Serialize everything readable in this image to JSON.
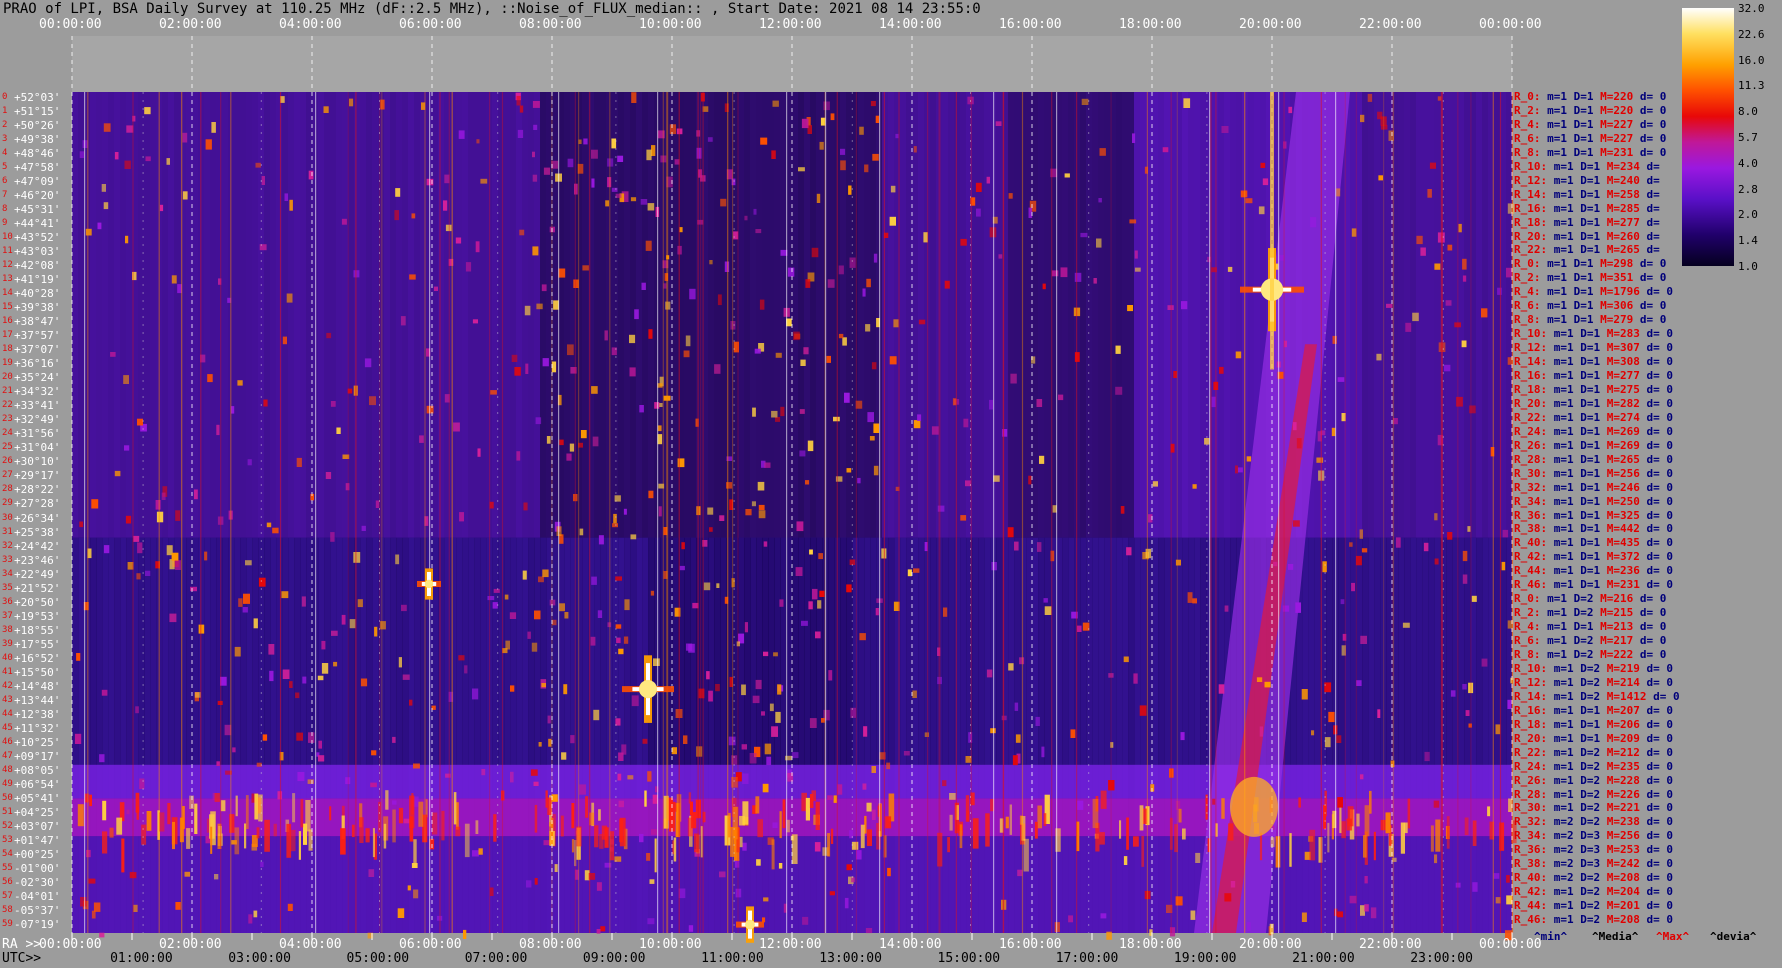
{
  "title": "PRAO of LPI, BSA Daily Survey at 110.25 MHz (dF::2.5 MHz), ::Noise_of_FLUX_median:: , Start Date: 2021 08 14 23:55:0",
  "chart_data": {
    "type": "heatmap",
    "title": "PRAO of LPI, BSA Daily Survey at 110.25 MHz (dF::2.5 MHz), ::Noise_of_FLUX_median:: , Start Date: 2021 08 14 23:55:0",
    "top_axis_labels": [
      "00:00:00",
      "02:00:00",
      "04:00:00",
      "06:00:00",
      "08:00:00",
      "10:00:00",
      "12:00:00",
      "14:00:00",
      "16:00:00",
      "18:00:00",
      "20:00:00",
      "22:00:00",
      "00:00:00"
    ],
    "ra_axis_prefix": "RA >>",
    "ra_axis_labels": [
      "00:00:00",
      "02:00:00",
      "04:00:00",
      "06:00:00",
      "08:00:00",
      "10:00:00",
      "12:00:00",
      "14:00:00",
      "16:00:00",
      "18:00:00",
      "20:00:00",
      "22:00:00",
      "00:00:00"
    ],
    "utc_axis_prefix": "UTC>>",
    "utc_axis_labels": [
      "01:00:00",
      "03:00:00",
      "05:00:00",
      "07:00:00",
      "09:00:00",
      "11:00:00",
      "13:00:00",
      "15:00:00",
      "17:00:00",
      "19:00:00",
      "21:00:00",
      "23:00:00"
    ],
    "declinations": [
      "+52°03'",
      "+51°15'",
      "+50°26'",
      "+49°38'",
      "+48°46'",
      "+47°58'",
      "+47°09'",
      "+46°20'",
      "+45°31'",
      "+44°41'",
      "+43°52'",
      "+43°03'",
      "+42°08'",
      "+41°19'",
      "+40°28'",
      "+39°38'",
      "+38°47'",
      "+37°57'",
      "+37°07'",
      "+36°16'",
      "+35°24'",
      "+34°32'",
      "+33°41'",
      "+32°49'",
      "+31°56'",
      "+31°04'",
      "+30°10'",
      "+29°17'",
      "+28°22'",
      "+27°28'",
      "+26°34'",
      "+25°38'",
      "+24°42'",
      "+23°46'",
      "+22°49'",
      "+21°52'",
      "+20°50'",
      "+19°53'",
      "+18°55'",
      "+17°55'",
      "+16°52'",
      "+15°50'",
      "+14°48'",
      "+13°44'",
      "+12°38'",
      "+11°32'",
      "+10°25'",
      "+09°17'",
      "+08°05'",
      "+06°54'",
      "+05°41'",
      "+04°25'",
      "+03°07'",
      "+01°47'",
      "+00°25'",
      "-01°00'",
      "-02°30'",
      "-04°01'",
      "-05°37'",
      "-07°19'"
    ],
    "colorbar": {
      "ticks": [
        "32.0",
        "22.6",
        "16.0",
        "11.3",
        "8.0",
        "5.7",
        "4.0",
        "2.8",
        "2.0",
        "1.4",
        "1.0"
      ],
      "values": [
        32.0,
        22.6,
        16.0,
        11.3,
        8.0,
        5.7,
        4.0,
        2.8,
        2.0,
        1.4,
        1.0
      ],
      "colors": [
        "#ffffff",
        "#fff0a0",
        "#ffc000",
        "#ff7000",
        "#ff1a00",
        "#d80850",
        "#a010c0",
        "#7a12e0",
        "#4a0cb0",
        "#1c0060",
        "#04001a"
      ]
    },
    "sources": [
      {
        "ra": "20:00:00",
        "dec": "+41°19'",
        "intensity": "max"
      },
      {
        "ra": "09:40:00",
        "dec": "+14°48'",
        "intensity": "high"
      },
      {
        "ra": "11:30:00",
        "dec": "-07°19'",
        "intensity": "high"
      },
      {
        "ra": "06:00:00",
        "dec": "+21°52'",
        "intensity": "medium"
      },
      {
        "ra": "19:40:00",
        "dec": "+00°25'",
        "intensity": "high"
      }
    ],
    "stats": [
      {
        "r": "R_0:",
        "m": "m=1",
        "d": "D=1",
        "max": "M=220",
        "dv": "d= 0"
      },
      {
        "r": "R_2:",
        "m": "m=1",
        "d": "D=1",
        "max": "M=220",
        "dv": "d= 0"
      },
      {
        "r": "R_4:",
        "m": "m=1",
        "d": "D=1",
        "max": "M=227",
        "dv": "d= 0"
      },
      {
        "r": "R_6:",
        "m": "m=1",
        "d": "D=1",
        "max": "M=227",
        "dv": "d= 0"
      },
      {
        "r": "R_8:",
        "m": "m=1",
        "d": "D=1",
        "max": "M=231",
        "dv": "d= 0"
      },
      {
        "r": "R_10:",
        "m": "m=1",
        "d": "D=1",
        "max": "M=234",
        "dv": "d="
      },
      {
        "r": "R_12:",
        "m": "m=1",
        "d": "D=1",
        "max": "M=240",
        "dv": "d="
      },
      {
        "r": "R_14:",
        "m": "m=1",
        "d": "D=1",
        "max": "M=258",
        "dv": "d="
      },
      {
        "r": "R_16:",
        "m": "m=1",
        "d": "D=1",
        "max": "M=285",
        "dv": "d="
      },
      {
        "r": "R_18:",
        "m": "m=1",
        "d": "D=1",
        "max": "M=277",
        "dv": "d="
      },
      {
        "r": "R_20:",
        "m": "m=1",
        "d": "D=1",
        "max": "M=260",
        "dv": "d="
      },
      {
        "r": "R_22:",
        "m": "m=1",
        "d": "D=1",
        "max": "M=265",
        "dv": "d="
      },
      {
        "r": "R_0:",
        "m": "m=1",
        "d": "D=1",
        "max": "M=298",
        "dv": "d= 0"
      },
      {
        "r": "R_2:",
        "m": "m=1",
        "d": "D=1",
        "max": "M=351",
        "dv": "d= 0"
      },
      {
        "r": "R_4:",
        "m": "m=1",
        "d": "D=1",
        "max": "M=1796",
        "dv": "d= 0"
      },
      {
        "r": "R_6:",
        "m": "m=1",
        "d": "D=1",
        "max": "M=306",
        "dv": "d= 0"
      },
      {
        "r": "R_8:",
        "m": "m=1",
        "d": "D=1",
        "max": "M=279",
        "dv": "d= 0"
      },
      {
        "r": "R_10:",
        "m": "m=1",
        "d": "D=1",
        "max": "M=283",
        "dv": "d= 0"
      },
      {
        "r": "R_12:",
        "m": "m=1",
        "d": "D=1",
        "max": "M=307",
        "dv": "d= 0"
      },
      {
        "r": "R_14:",
        "m": "m=1",
        "d": "D=1",
        "max": "M=308",
        "dv": "d= 0"
      },
      {
        "r": "R_16:",
        "m": "m=1",
        "d": "D=1",
        "max": "M=277",
        "dv": "d= 0"
      },
      {
        "r": "R_18:",
        "m": "m=1",
        "d": "D=1",
        "max": "M=275",
        "dv": "d= 0"
      },
      {
        "r": "R_20:",
        "m": "m=1",
        "d": "D=1",
        "max": "M=282",
        "dv": "d= 0"
      },
      {
        "r": "R_22:",
        "m": "m=1",
        "d": "D=1",
        "max": "M=274",
        "dv": "d= 0"
      },
      {
        "r": "R_24:",
        "m": "m=1",
        "d": "D=1",
        "max": "M=269",
        "dv": "d= 0"
      },
      {
        "r": "R_26:",
        "m": "m=1",
        "d": "D=1",
        "max": "M=269",
        "dv": "d= 0"
      },
      {
        "r": "R_28:",
        "m": "m=1",
        "d": "D=1",
        "max": "M=265",
        "dv": "d= 0"
      },
      {
        "r": "R_30:",
        "m": "m=1",
        "d": "D=1",
        "max": "M=256",
        "dv": "d= 0"
      },
      {
        "r": "R_32:",
        "m": "m=1",
        "d": "D=1",
        "max": "M=246",
        "dv": "d= 0"
      },
      {
        "r": "R_34:",
        "m": "m=1",
        "d": "D=1",
        "max": "M=250",
        "dv": "d= 0"
      },
      {
        "r": "R_36:",
        "m": "m=1",
        "d": "D=1",
        "max": "M=325",
        "dv": "d= 0"
      },
      {
        "r": "R_38:",
        "m": "m=1",
        "d": "D=1",
        "max": "M=442",
        "dv": "d= 0"
      },
      {
        "r": "R_40:",
        "m": "m=1",
        "d": "D=1",
        "max": "M=435",
        "dv": "d= 0"
      },
      {
        "r": "R_42:",
        "m": "m=1",
        "d": "D=1",
        "max": "M=372",
        "dv": "d= 0"
      },
      {
        "r": "R_44:",
        "m": "m=1",
        "d": "D=1",
        "max": "M=236",
        "dv": "d= 0"
      },
      {
        "r": "R_46:",
        "m": "m=1",
        "d": "D=1",
        "max": "M=231",
        "dv": "d= 0"
      },
      {
        "r": "R_0:",
        "m": "m=1",
        "d": "D=2",
        "max": "M=216",
        "dv": "d= 0"
      },
      {
        "r": "R_2:",
        "m": "m=1",
        "d": "D=2",
        "max": "M=215",
        "dv": "d= 0"
      },
      {
        "r": "R_4:",
        "m": "m=1",
        "d": "D=1",
        "max": "M=213",
        "dv": "d= 0"
      },
      {
        "r": "R_6:",
        "m": "m=1",
        "d": "D=2",
        "max": "M=217",
        "dv": "d= 0"
      },
      {
        "r": "R_8:",
        "m": "m=1",
        "d": "D=2",
        "max": "M=222",
        "dv": "d= 0"
      },
      {
        "r": "R_10:",
        "m": "m=1",
        "d": "D=2",
        "max": "M=219",
        "dv": "d= 0"
      },
      {
        "r": "R_12:",
        "m": "m=1",
        "d": "D=2",
        "max": "M=214",
        "dv": "d= 0"
      },
      {
        "r": "R_14:",
        "m": "m=1",
        "d": "D=2",
        "max": "M=1412",
        "dv": "d= 0"
      },
      {
        "r": "R_16:",
        "m": "m=1",
        "d": "D=1",
        "max": "M=207",
        "dv": "d= 0"
      },
      {
        "r": "R_18:",
        "m": "m=1",
        "d": "D=1",
        "max": "M=206",
        "dv": "d= 0"
      },
      {
        "r": "R_20:",
        "m": "m=1",
        "d": "D=1",
        "max": "M=209",
        "dv": "d= 0"
      },
      {
        "r": "R_22:",
        "m": "m=1",
        "d": "D=2",
        "max": "M=212",
        "dv": "d= 0"
      },
      {
        "r": "R_24:",
        "m": "m=1",
        "d": "D=2",
        "max": "M=235",
        "dv": "d= 0"
      },
      {
        "r": "R_26:",
        "m": "m=1",
        "d": "D=2",
        "max": "M=228",
        "dv": "d= 0"
      },
      {
        "r": "R_28:",
        "m": "m=1",
        "d": "D=2",
        "max": "M=226",
        "dv": "d= 0"
      },
      {
        "r": "R_30:",
        "m": "m=1",
        "d": "D=2",
        "max": "M=221",
        "dv": "d= 0"
      },
      {
        "r": "R_32:",
        "m": "m=2",
        "d": "D=2",
        "max": "M=238",
        "dv": "d= 0"
      },
      {
        "r": "R_34:",
        "m": "m=2",
        "d": "D=3",
        "max": "M=256",
        "dv": "d= 0"
      },
      {
        "r": "R_36:",
        "m": "m=2",
        "d": "D=3",
        "max": "M=253",
        "dv": "d= 0"
      },
      {
        "r": "R_38:",
        "m": "m=2",
        "d": "D=3",
        "max": "M=242",
        "dv": "d= 0"
      },
      {
        "r": "R_40:",
        "m": "m=2",
        "d": "D=2",
        "max": "M=208",
        "dv": "d= 0"
      },
      {
        "r": "R_42:",
        "m": "m=1",
        "d": "D=2",
        "max": "M=204",
        "dv": "d= 0"
      },
      {
        "r": "R_44:",
        "m": "m=1",
        "d": "D=2",
        "max": "M=201",
        "dv": "d= 0"
      },
      {
        "r": "R_46:",
        "m": "m=1",
        "d": "D=2",
        "max": "M=208",
        "dv": "d= 0"
      }
    ],
    "legend": [
      "^min^",
      "^Media^",
      "^Max^",
      "^devia^"
    ]
  }
}
